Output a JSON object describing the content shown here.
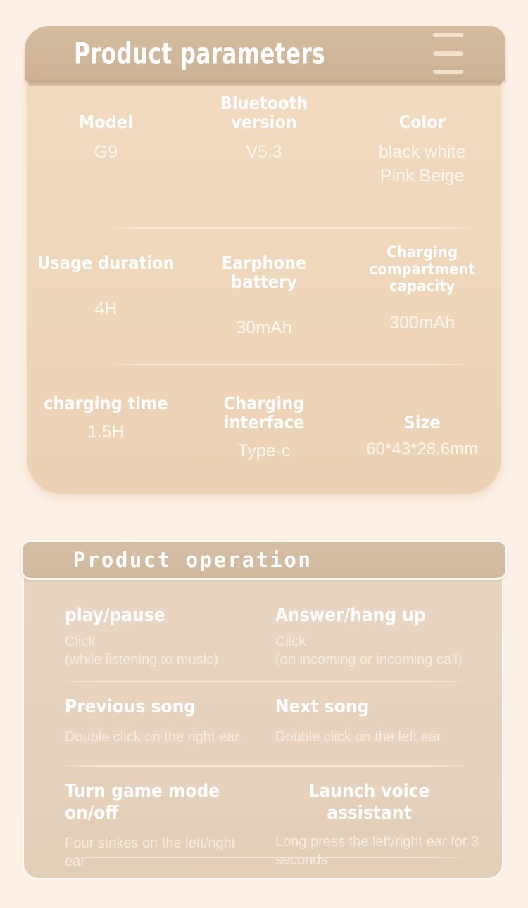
{
  "background_color": "#FDF1E7",
  "parameters_section": {
    "header": {
      "title": "Product parameters",
      "menu_icon": "hamburger-menu-icon",
      "bar_color": "#D1B89A"
    },
    "card_color": "#EFD8BE",
    "rows": [
      {
        "cells": [
          {
            "label": "Model",
            "value": "G9"
          },
          {
            "label": "Bluetooth version",
            "value": "V5.3"
          },
          {
            "label": "Color",
            "value": "black white\nPink Beige"
          }
        ]
      },
      {
        "cells": [
          {
            "label": "Usage duration",
            "value": "4H"
          },
          {
            "label": "Earphone battery",
            "value": "30mAh"
          },
          {
            "label": "Charging compartment capacity",
            "value": "300mAh"
          }
        ]
      },
      {
        "cells": [
          {
            "label": "charging time",
            "value": "1.5H"
          },
          {
            "label": "Charging interface",
            "value": "Type-c"
          },
          {
            "label": "Size",
            "value": "60*43*28.6mm"
          }
        ]
      }
    ]
  },
  "operation_section": {
    "header": {
      "title": "Product  operation",
      "bar_color": "#D3BCA2"
    },
    "card_color": "#E6D2BD",
    "rows": [
      {
        "left": {
          "title": "play/pause",
          "desc": "Click\n(while listening to music)"
        },
        "right": {
          "title": "Answer/hang up",
          "desc": "Click\n(on incoming or incoming call)"
        }
      },
      {
        "left": {
          "title": "Previous song",
          "desc": "Double click on the right ear"
        },
        "right": {
          "title": "Next song",
          "desc": "Double click on the left ear"
        }
      },
      {
        "left": {
          "title": "Turn game mode on/off",
          "desc": "Four strikes on the left/right ear"
        },
        "right": {
          "title": "Launch voice assistant",
          "desc": "Long press the left/right ear for 3 seconds"
        }
      }
    ]
  }
}
